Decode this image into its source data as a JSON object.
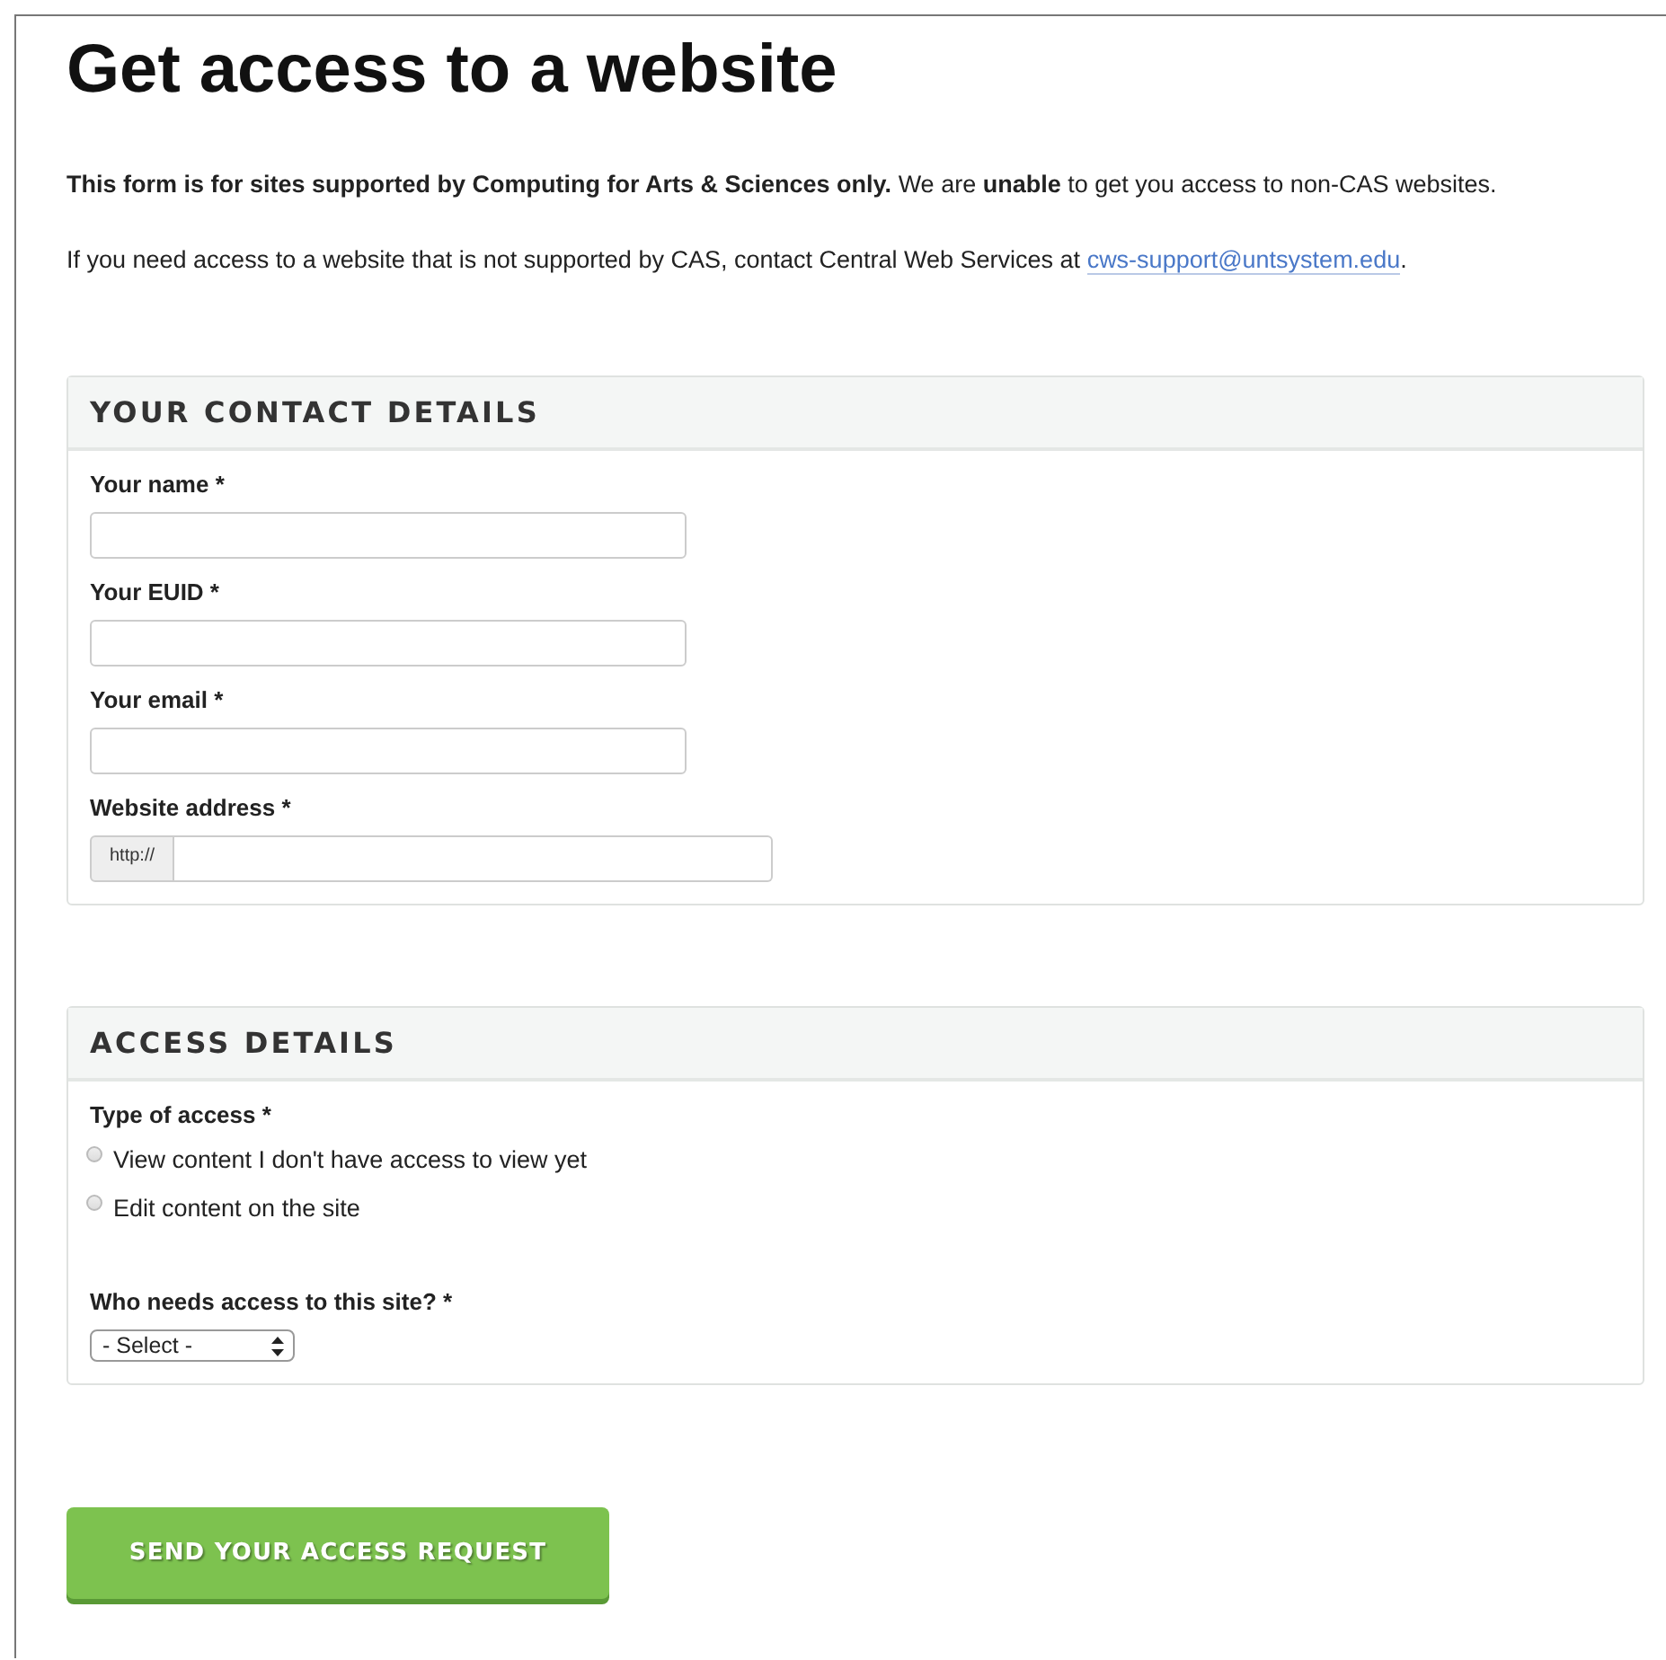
{
  "title": "Get access to a website",
  "intro": [
    "**This form is for sites supported by Computing for Arts & Sciences only.** We are **unable** to get you access to non-CAS websites."
  ],
  "contact_note": {
    "text": "If you need access to a website that is not supported by CAS, contact Central Web Services at",
    "link": "cws-support@untsystem.edu",
    "after": "."
  },
  "sections": [
    {
      "heading": "YOUR CONTACT DETAILS",
      "fields": [
        {
          "kind": "text",
          "label": "Your name *"
        },
        {
          "kind": "text",
          "label": "Your EUID *"
        },
        {
          "kind": "text",
          "label": "Your email *"
        },
        {
          "kind": "prefixed",
          "label": "Website address *",
          "prefix": "http://"
        }
      ]
    },
    {
      "heading": "ACCESS DETAILS",
      "fields": [
        {
          "kind": "radio",
          "label": "Type of access *",
          "options": [
            {
              "label": "View content I don't have access to view yet",
              "selected": false
            },
            {
              "label": "Edit content on the site",
              "selected": false
            }
          ]
        },
        {
          "kind": "select",
          "label": "Who needs access to this site? *",
          "value": "- Select -"
        }
      ]
    }
  ],
  "submit": "SEND YOUR ACCESS REQUEST"
}
